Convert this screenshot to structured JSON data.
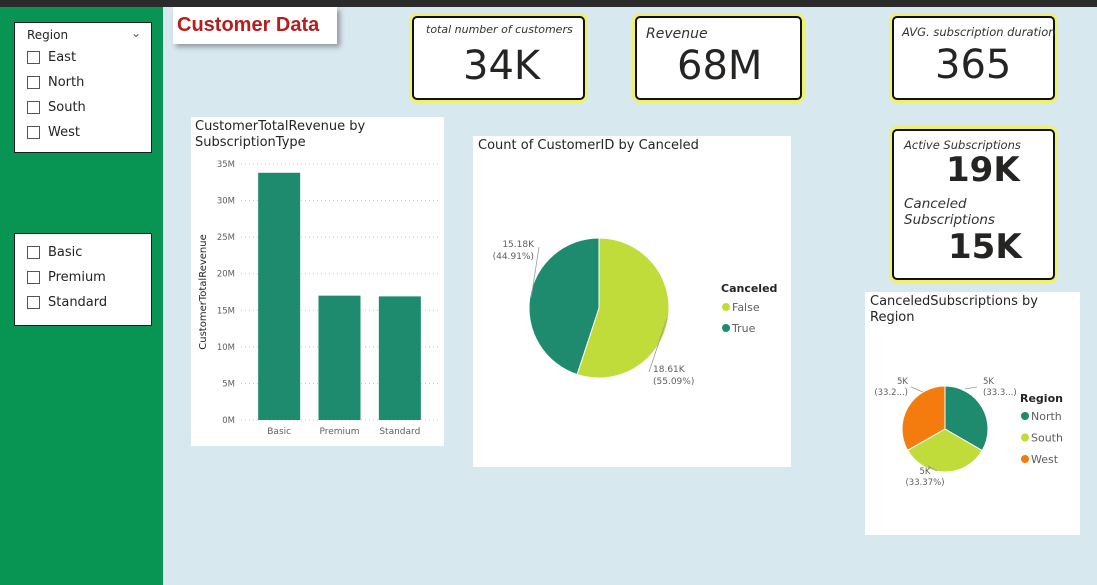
{
  "page": {
    "title": "Customer Data"
  },
  "slicers": {
    "region": {
      "title": "Region",
      "options": [
        "East",
        "North",
        "South",
        "West"
      ]
    },
    "subscription": {
      "options": [
        "Basic",
        "Premium",
        "Standard"
      ]
    }
  },
  "cards": {
    "customers": {
      "label": "total number of customers",
      "value": "34K"
    },
    "revenue": {
      "label": "Revenue",
      "value": "68M"
    },
    "duration": {
      "label": "AVG. subscription duration",
      "value": "365"
    },
    "active": {
      "label": "Active Subscriptions",
      "value": "19K"
    },
    "canceled": {
      "label": "Canceled Subscriptions",
      "value": "15K"
    }
  },
  "colors": {
    "teal": "#1e8a6e",
    "lime": "#c0dc3a",
    "orange": "#f47b0e",
    "sidebar": "#089553",
    "card_border": "#f0f06a",
    "title_red": "#b91c1c"
  },
  "chart_data": [
    {
      "type": "bar",
      "title": "CustomerTotalRevenue by SubscriptionType",
      "xlabel": "",
      "ylabel": "CustomerTotalRevenue",
      "categories": [
        "Basic",
        "Premium",
        "Standard"
      ],
      "values": [
        33.8,
        17.0,
        16.9
      ],
      "value_unit": "M",
      "ylim": [
        0,
        35
      ],
      "yticks": [
        "0M",
        "5M",
        "10M",
        "15M",
        "20M",
        "25M",
        "30M",
        "35M"
      ],
      "grid": true,
      "color": "#1e8a6e"
    },
    {
      "type": "pie",
      "title": "Count of CustomerID by Canceled",
      "legend_title": "Canceled",
      "legend_position": "right",
      "slices": [
        {
          "label": "False",
          "value": 18.61,
          "display": "18.61K",
          "pct": "(55.09%)",
          "color": "#c0dc3a"
        },
        {
          "label": "True",
          "value": 15.18,
          "display": "15.18K",
          "pct": "(44.91%)",
          "color": "#1e8a6e"
        }
      ]
    },
    {
      "type": "pie",
      "title": "CanceledSubscriptions by Region",
      "legend_title": "Region",
      "legend_position": "right",
      "slices": [
        {
          "label": "North",
          "value": 33.3,
          "display": "5K",
          "pct": "(33.3...)",
          "color": "#1e8a6e"
        },
        {
          "label": "South",
          "value": 33.37,
          "display": "5K",
          "pct": "(33.37%)",
          "color": "#c0dc3a"
        },
        {
          "label": "West",
          "value": 33.2,
          "display": "5K",
          "pct": "(33.2...)",
          "color": "#f47b0e"
        }
      ]
    }
  ]
}
